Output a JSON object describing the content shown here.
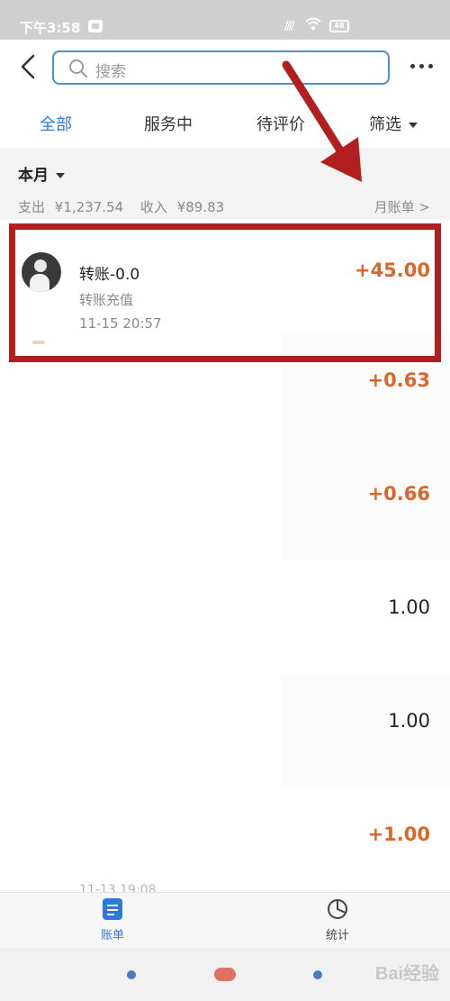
{
  "status_bar": {
    "time": "下午3:58",
    "signal": "////",
    "battery": "48"
  },
  "top_bar": {
    "search_placeholder": "搜索"
  },
  "tabs": [
    {
      "label": "全部",
      "active": true
    },
    {
      "label": "服务中",
      "active": false
    },
    {
      "label": "待评价",
      "active": false
    },
    {
      "label": "筛选",
      "active": false
    }
  ],
  "month": {
    "title": "本月",
    "expense_label": "支出",
    "expense_value": "¥1,237.54",
    "income_label": "收入",
    "income_value": "¥89.83",
    "bill_link": "月账单 >"
  },
  "transactions": [
    {
      "title": "转账-0.0",
      "subtitle": "转账充值",
      "time": "11-15  20:57",
      "amount": "+45.00"
    },
    {
      "amount": "+0.63"
    },
    {
      "amount": "+0.66"
    },
    {
      "amount": "1.00"
    },
    {
      "amount": "1.00"
    },
    {
      "amount": "+1.00"
    }
  ],
  "faded_time": "11-13  19:08",
  "bottom_nav": [
    {
      "label": "账单",
      "active": true
    },
    {
      "label": "统计",
      "active": false
    }
  ],
  "watermark": "Bai经验",
  "colors": {
    "accent": "#2b7bd6",
    "positive": "#d9662b",
    "highlight": "#b21f1f"
  }
}
